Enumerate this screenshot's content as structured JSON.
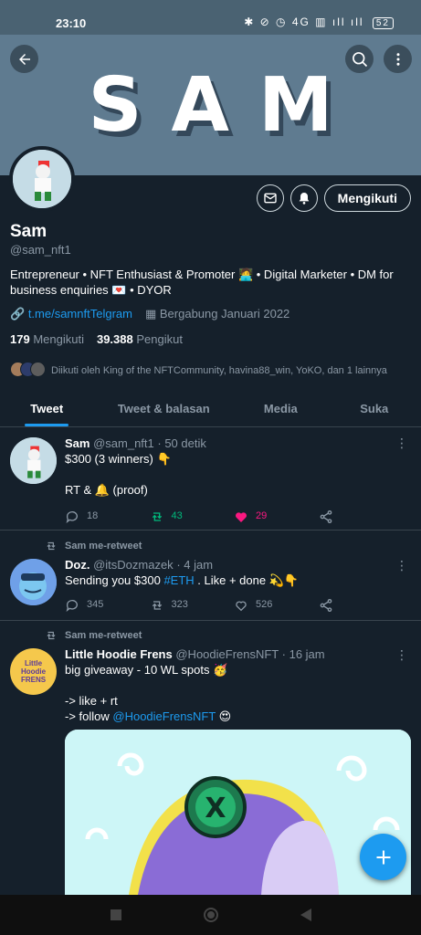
{
  "status": {
    "time": "23:10",
    "icons": "✱ ⊘ ◷ 4G ▥ ıll ıll",
    "battery": "52"
  },
  "banner": {
    "text": "SAM"
  },
  "profile": {
    "name": "Sam",
    "handle": "@sam_nft1",
    "follow_label": "Mengikuti",
    "bio": "Entrepreneur • NFT Enthusiast & Promoter 🧑‍💻 • Digital Marketer • DM for business enquiries 💌 • DYOR",
    "link": "t.me/samnftTelgram",
    "joined": "Bergabung Januari 2022",
    "following_count": "179",
    "following_label": "Mengikuti",
    "followers_count": "39.388",
    "followers_label": "Pengikut",
    "followed_by": "Diikuti oleh King of the NFTCommunity, havina88_win, YoKO, dan 1 lainnya"
  },
  "tabs": [
    "Tweet",
    "Tweet & balasan",
    "Media",
    "Suka"
  ],
  "tweets": [
    {
      "name": "Sam",
      "handle": "@sam_nft1",
      "time": "· 50 detik",
      "line1": "$300 (3 winners) 👇",
      "line2": "RT & 🔔 (proof)",
      "replies": "18",
      "retweets": "43",
      "likes": "29"
    },
    {
      "retweet_label": "Sam me-retweet",
      "name": "Doz.",
      "handle": "@itsDozmazek",
      "time": "· 4 jam",
      "text_before": "Sending you $300 ",
      "hashtag": "#ETH",
      "text_after": " . Like + done 💫👇",
      "replies": "345",
      "retweets": "323",
      "likes": "526"
    },
    {
      "retweet_label": "Sam me-retweet",
      "name": "Little Hoodie Frens",
      "handle": "@HoodieFrensNFT",
      "time": "· 16 jam",
      "line1": "big giveaway - 10 WL spots 🥳",
      "line2": "-> like + rt",
      "line3_before": "-> follow ",
      "mention": "@HoodieFrensNFT",
      "line3_after": " 😍",
      "avatar_text": "Little Hoodie FRENS"
    }
  ],
  "colors": {
    "accent": "#1d9bf0",
    "bg": "#15202b",
    "retweet": "#00ba7c",
    "like": "#f91880"
  }
}
